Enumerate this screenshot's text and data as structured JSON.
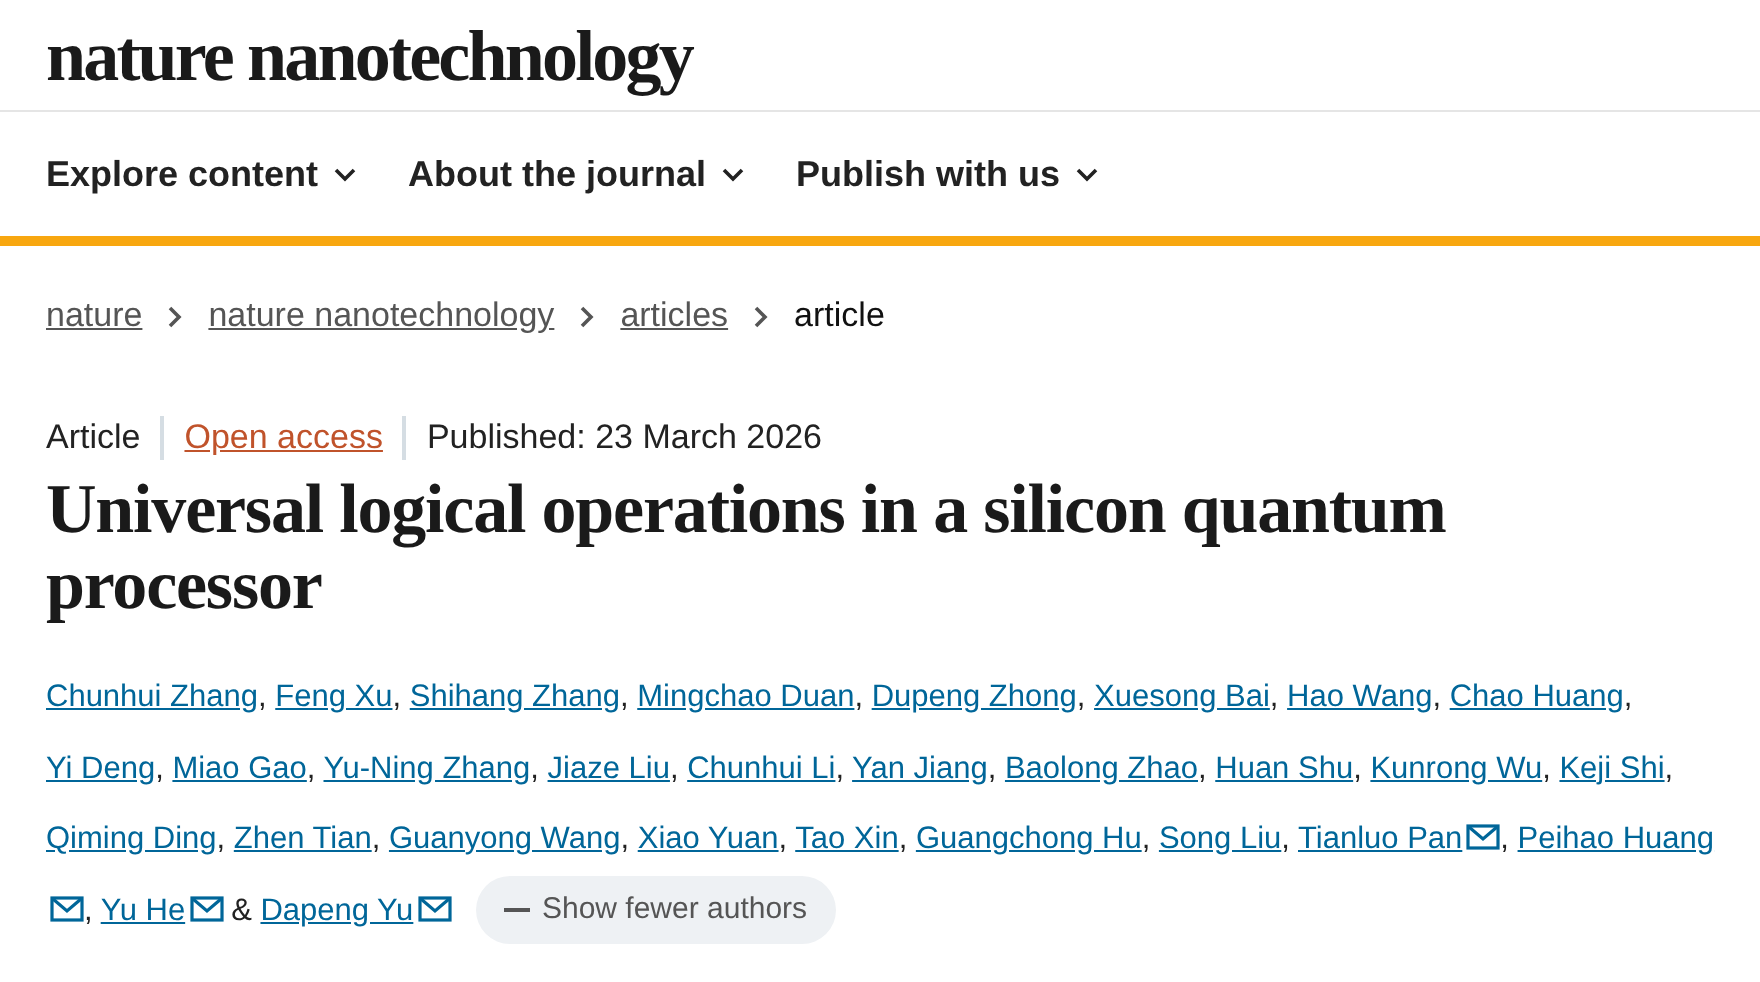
{
  "logo": "nature nanotechnology",
  "nav": [
    {
      "label": "Explore content"
    },
    {
      "label": "About the journal"
    },
    {
      "label": "Publish with us"
    }
  ],
  "breadcrumbs": [
    {
      "label": "nature",
      "link": true
    },
    {
      "label": "nature nanotechnology",
      "link": true
    },
    {
      "label": "articles",
      "link": true
    },
    {
      "label": "article",
      "link": false
    }
  ],
  "meta": [
    {
      "kind": "type",
      "text": "Article"
    },
    {
      "kind": "access",
      "text": "Open access"
    },
    {
      "kind": "date",
      "text": "Published: 23 March 2026"
    }
  ],
  "title": "Universal logical operations in a silicon quantum processor",
  "authors": [
    {
      "name": "Chunhui Zhang",
      "contact": false,
      "after": ","
    },
    {
      "name": "Feng Xu",
      "contact": false,
      "after": ","
    },
    {
      "name": "Shihang Zhang",
      "contact": false,
      "after": ","
    },
    {
      "name": "Mingchao Duan",
      "contact": false,
      "after": ","
    },
    {
      "name": "Dupeng Zhong",
      "contact": false,
      "after": ","
    },
    {
      "name": "Xuesong Bai",
      "contact": false,
      "after": ","
    },
    {
      "name": "Hao Wang",
      "contact": false,
      "after": ","
    },
    {
      "name": "Chao Huang",
      "contact": false,
      "after": ","
    },
    {
      "name": "Yi Deng",
      "contact": false,
      "after": ","
    },
    {
      "name": "Miao Gao",
      "contact": false,
      "after": ","
    },
    {
      "name": "Yu-Ning Zhang",
      "contact": false,
      "after": ","
    },
    {
      "name": "Jiaze Liu",
      "contact": false,
      "after": ","
    },
    {
      "name": "Chunhui Li",
      "contact": false,
      "after": ","
    },
    {
      "name": "Yan Jiang",
      "contact": false,
      "after": ","
    },
    {
      "name": "Baolong Zhao",
      "contact": false,
      "after": ","
    },
    {
      "name": "Huan Shu",
      "contact": false,
      "after": ","
    },
    {
      "name": "Kunrong Wu",
      "contact": false,
      "after": ","
    },
    {
      "name": "Keji Shi",
      "contact": false,
      "after": ","
    },
    {
      "name": "Qiming Ding",
      "contact": false,
      "after": ","
    },
    {
      "name": "Zhen Tian",
      "contact": false,
      "after": ","
    },
    {
      "name": "Guanyong Wang",
      "contact": false,
      "after": ","
    },
    {
      "name": "Xiao Yuan",
      "contact": false,
      "after": ","
    },
    {
      "name": "Tao Xin",
      "contact": false,
      "after": ","
    },
    {
      "name": "Guangchong Hu",
      "contact": false,
      "after": ","
    },
    {
      "name": "Song Liu",
      "contact": false,
      "after": ","
    },
    {
      "name": "Tianluo Pan",
      "contact": true,
      "after": ","
    },
    {
      "name": "Peihao Huang",
      "contact": true,
      "after": ","
    },
    {
      "name": "Yu He",
      "contact": true,
      "after": "&"
    },
    {
      "name": "Dapeng Yu",
      "contact": true
    }
  ],
  "toggle": {
    "label": "Show fewer authors"
  }
}
